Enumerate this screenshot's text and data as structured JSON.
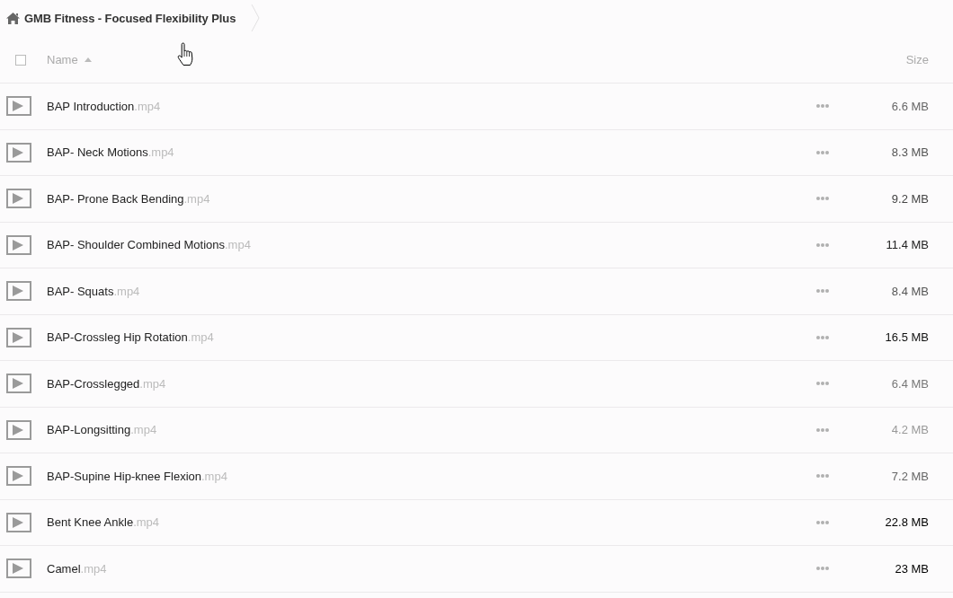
{
  "breadcrumb": {
    "title": "GMB Fitness - Focused Flexibility Plus"
  },
  "table": {
    "header": {
      "checked": false,
      "name": "Name",
      "sort_ascending": true,
      "size": "Size"
    },
    "rows": [
      {
        "name": "BAP Introduction",
        "extension": ".mp4",
        "size": "6.6 MB",
        "color": "#666666"
      },
      {
        "name": "BAP- Neck Motions",
        "extension": ".mp4",
        "size": "8.3 MB",
        "color": "#555555"
      },
      {
        "name": "BAP- Prone Back Bending",
        "extension": ".mp4",
        "size": "9.2 MB",
        "color": "#444444"
      },
      {
        "name": "BAP- Shoulder Combined Motions",
        "extension": ".mp4",
        "size": "11.4 MB",
        "color": "#222222"
      },
      {
        "name": "BAP- Squats",
        "extension": ".mp4",
        "size": "8.4 MB",
        "color": "#555555"
      },
      {
        "name": "BAP-Crossleg Hip Rotation",
        "extension": ".mp4",
        "size": "16.5 MB",
        "color": "#111111"
      },
      {
        "name": "BAP-Crosslegged",
        "extension": ".mp4",
        "size": "6.4 MB",
        "color": "#777777"
      },
      {
        "name": "BAP-Longsitting",
        "extension": ".mp4",
        "size": "4.2 MB",
        "color": "#999999"
      },
      {
        "name": "BAP-Supine Hip-knee Flexion",
        "extension": ".mp4",
        "size": "7.2 MB",
        "color": "#666666"
      },
      {
        "name": "Bent Knee Ankle",
        "extension": ".mp4",
        "size": "22.8 MB",
        "color": "#000000"
      },
      {
        "name": "Camel",
        "extension": ".mp4",
        "size": "23 MB",
        "color": "#000000"
      }
    ]
  }
}
